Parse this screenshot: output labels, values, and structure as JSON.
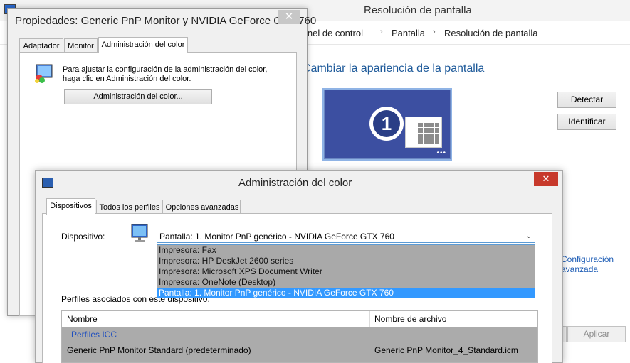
{
  "background_window": {
    "title": "Resolución de pantalla",
    "breadcrumb": [
      "Panel de control",
      "Pantalla",
      "Resolución de pantalla"
    ],
    "heading": "Cambiar la apariencia de la pantalla",
    "monitor_number": "1",
    "detect_label": "Detectar",
    "identify_label": "Identificar",
    "advanced_link": "Configuración avanzada",
    "apply_label": "Aplicar"
  },
  "properties_dialog": {
    "title": "Propiedades: Generic PnP Monitor y NVIDIA GeForce GTX 760",
    "tabs": [
      "Adaptador",
      "Monitor",
      "Administración del color"
    ],
    "active_tab": "Administración del color",
    "description_line1": "Para ajustar la configuración de la administración del color,",
    "description_line2": "haga clic en Administración del color.",
    "button_label": "Administración del color..."
  },
  "color_management_dialog": {
    "title": "Administración del color",
    "tabs": [
      "Dispositivos",
      "Todos los perfiles",
      "Opciones avanzadas"
    ],
    "active_tab": "Dispositivos",
    "device_label": "Dispositivo:",
    "selected_device": "Pantalla: 1. Monitor PnP genérico - NVIDIA GeForce GTX 760",
    "device_options": [
      "Impresora: Fax",
      "Impresora: HP DeskJet 2600 series",
      "Impresora: Microsoft XPS Document Writer",
      "Impresora: OneNote (Desktop)",
      "Pantalla: 1. Monitor PnP genérico - NVIDIA GeForce GTX 760"
    ],
    "profiles_label": "Perfiles asociados con este dispositivo:",
    "columns": [
      "Nombre",
      "Nombre de archivo"
    ],
    "group_label": "Perfiles ICC",
    "rows": [
      {
        "name": "Generic PnP Monitor Standard (predeterminado)",
        "file": "Generic PnP Monitor_4_Standard.icm"
      }
    ]
  }
}
